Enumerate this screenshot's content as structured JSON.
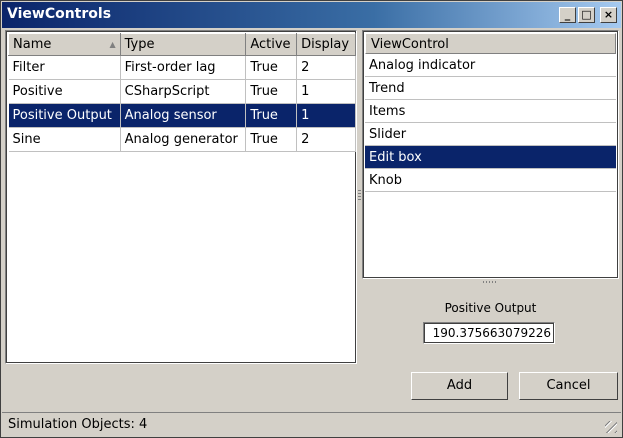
{
  "window": {
    "title": "ViewControls"
  },
  "title_buttons": {
    "minimize": "_",
    "maximize": "□",
    "close": "×"
  },
  "objects_table": {
    "columns": [
      "Name",
      "Type",
      "Active",
      "Display"
    ],
    "rows": [
      [
        "Filter",
        "First-order lag",
        "True",
        "2"
      ],
      [
        "Positive",
        "CSharpScript",
        "True",
        "1"
      ],
      [
        "Positive Output",
        "Analog sensor",
        "True",
        "1"
      ],
      [
        "Sine",
        "Analog generator",
        "True",
        "2"
      ]
    ],
    "selected_row": 2
  },
  "view_controls": {
    "header": "ViewControl",
    "items": [
      "Analog indicator",
      "Trend",
      "Items",
      "Slider",
      "Edit box",
      "Knob"
    ],
    "selected_index": 4
  },
  "preview": {
    "caption": "Positive Output",
    "value": "190.375663079226"
  },
  "buttons": {
    "add": "Add",
    "cancel": "Cancel"
  },
  "status": {
    "text": "Simulation Objects: 4"
  },
  "colors": {
    "selection": "#0a246a",
    "face": "#d4d0c8"
  }
}
